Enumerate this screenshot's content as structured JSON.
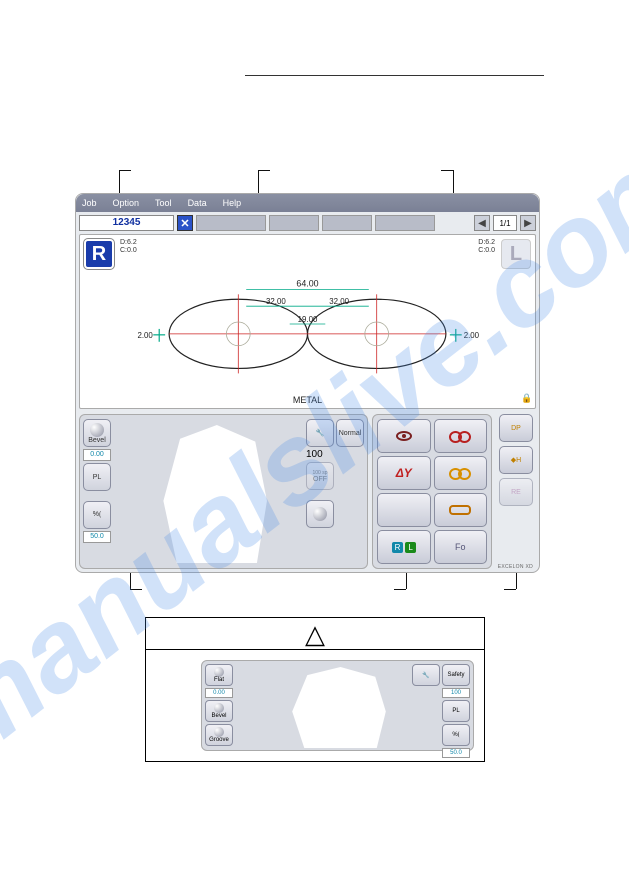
{
  "watermark": "manualslive.com",
  "menu": {
    "job": "Job",
    "option": "Option",
    "tool": "Tool",
    "data": "Data",
    "help": "Help"
  },
  "job_number": "12345",
  "page_indicator": "1/1",
  "readout": {
    "left": {
      "d": "D:6.2",
      "c": "C:0.0"
    },
    "right": {
      "d": "D:6.2",
      "c": "C:0.0"
    }
  },
  "frame_type": "METAL",
  "side_labels": {
    "R": "R",
    "L": "L"
  },
  "lens_dims": {
    "total": "64.00",
    "half_left": "32.00",
    "half_right": "32.00",
    "bridge": "19.00",
    "edge_left": "2.00",
    "edge_right": "2.00"
  },
  "bevel_panel": {
    "bevel_btn": "Bevel",
    "pl_btn": "PL",
    "pct_btn": "%",
    "bevel_val": "0.00",
    "pct_val": "50.0",
    "normal_btn": "Normal",
    "speed_val": "100",
    "speed_label": "100 sp",
    "off_label": "OFF"
  },
  "opt_panel": {
    "dp": "DP",
    "h": "H",
    "re": "RE",
    "dy": "ΔY",
    "rl": "R L",
    "fo": "Fo"
  },
  "brand": "EXCELON XD",
  "caution": {
    "flat": "Flat",
    "bevel": "Bevel",
    "groove": "Groove",
    "val0": "0.00",
    "safety": "Safety",
    "speed": "100",
    "pl": "PL",
    "pct": "%",
    "pct_val": "50.0"
  }
}
